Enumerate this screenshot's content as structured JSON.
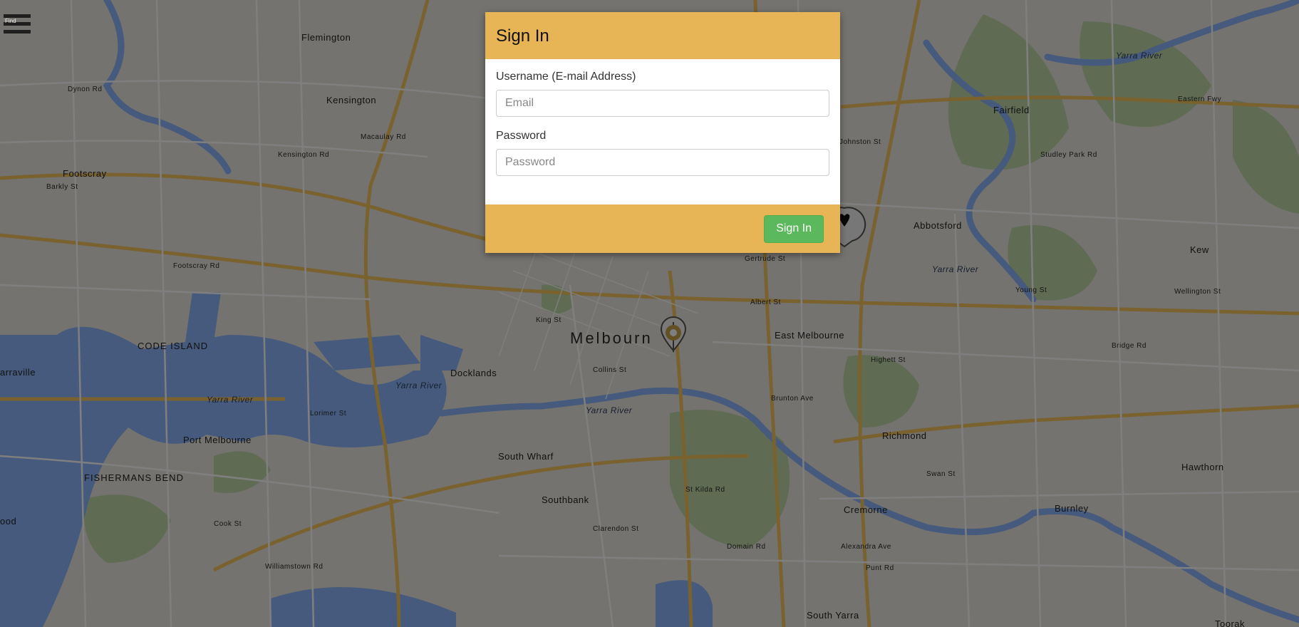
{
  "map": {
    "suburbs": [
      "Flemington",
      "Kensington",
      "Footscray",
      "Fairfield",
      "Abbotsford",
      "Kew",
      "East Melbourne",
      "Richmond",
      "Hawthorn",
      "Cremorne",
      "Burnley",
      "South Yarra",
      "Toorak",
      "Southbank",
      "South Wharf",
      "Docklands",
      "Port Melbourne",
      "CODE ISLAND",
      "FISHERMANS BEND"
    ],
    "city_label": "Melbourn",
    "water_labels": [
      "Yarra River",
      "Yarra River",
      "Yarra River",
      "Yarra River",
      "Yarra River"
    ],
    "street_labels": [
      "Footscray Rd",
      "Dynon Rd",
      "Kensington Rd",
      "Macaulay Rd",
      "Barkly St",
      "Eastern Fwy",
      "Johnston St",
      "Gertrude St",
      "Albert St",
      "Collins St",
      "Wellington St",
      "Alexandra Ave",
      "Lorimer St",
      "Williamstown Rd",
      "Cook St",
      "Highett St",
      "Swan St",
      "Bridge Rd",
      "King St",
      "Clarendon St",
      "St Kilda Rd",
      "Brunton Ave",
      "Domain Rd",
      "Punt Rd",
      "Young St",
      "Studley Park Rd"
    ],
    "partial_labels": [
      "arraville",
      "ood"
    ]
  },
  "menu": {
    "tiny_text": "Find"
  },
  "modal": {
    "title": "Sign In",
    "username_label": "Username (E-mail Address)",
    "username_placeholder": "Email",
    "username_value": "",
    "password_label": "Password",
    "password_placeholder": "Password",
    "password_value": "",
    "submit_label": "Sign In"
  },
  "colors": {
    "accent": "#e8b556",
    "button": "#5cb85c",
    "overlay": "#000000"
  },
  "icons": [
    "menu-icon",
    "location-marker-icon",
    "heart-marker-icon"
  ]
}
